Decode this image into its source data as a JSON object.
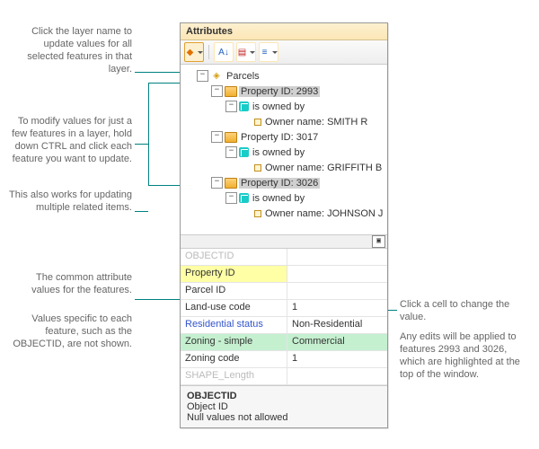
{
  "window": {
    "title": "Attributes"
  },
  "toolbar": {
    "btn1_name": "diamond-nav-icon",
    "btn2_name": "sort-icon",
    "btn3_name": "layers-icon",
    "btn4_name": "list-icon"
  },
  "tree": {
    "root": "Parcels",
    "items": [
      {
        "id": "Property ID: 2993",
        "rel": "is owned by",
        "owner": "Owner name: SMITH R",
        "selected": true
      },
      {
        "id": "Property ID: 3017",
        "rel": "is owned by",
        "owner": "Owner name: GRIFFITH B",
        "selected": false
      },
      {
        "id": "Property ID: 3026",
        "rel": "is owned by",
        "owner": "Owner name: JOHNSON J",
        "selected": true
      }
    ]
  },
  "grid": [
    {
      "name": "OBJECTID",
      "value": "",
      "style": "disabled"
    },
    {
      "name": "Property ID",
      "value": "",
      "style": "yellow"
    },
    {
      "name": "Parcel ID",
      "value": "",
      "style": ""
    },
    {
      "name": "Land-use code",
      "value": "1",
      "style": ""
    },
    {
      "name": "Residential status",
      "value": "Non-Residential",
      "style": "linky"
    },
    {
      "name": "Zoning - simple",
      "value": "Commercial",
      "style": "green"
    },
    {
      "name": "Zoning code",
      "value": "1",
      "style": ""
    },
    {
      "name": "SHAPE_Length",
      "value": "",
      "style": "disabled"
    }
  ],
  "info": {
    "header": "OBJECTID",
    "line1": "Object ID",
    "line2": "Null values not allowed"
  },
  "annotations": {
    "a1": "Click the layer name to update values for all selected features in that layer.",
    "a2": "To modify values for just a few features in a layer, hold down CTRL and click each feature you want to update.",
    "a3": "This also works for updating multiple related items.",
    "a4": "The common attribute values for the features.",
    "a5": "Values specific to each feature, such as the OBJECTID, are not shown.",
    "a6": "Click a cell to change the value.",
    "a7": "Any edits will be applied to features 2993 and 3026, which are highlighted at the top of the window."
  }
}
